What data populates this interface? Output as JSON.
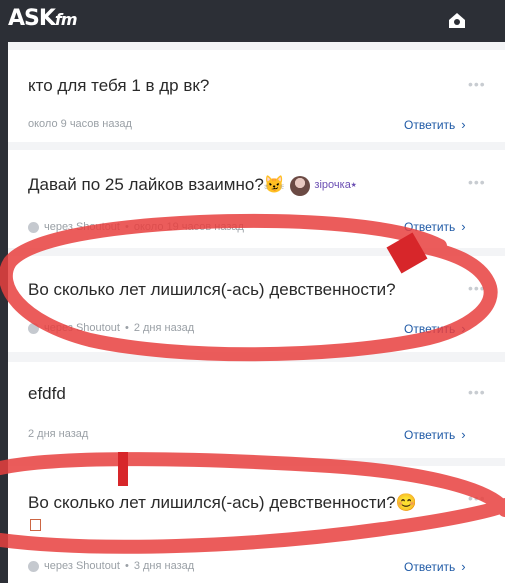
{
  "app": {
    "logo_main": "ASK",
    "logo_sub": "fm"
  },
  "colors": {
    "accent_link": "#1f5aa6",
    "scribble": "#e8403e"
  },
  "questions": [
    {
      "text": "кто для тебя 1 в др вк?",
      "via": "",
      "time": "около 9 часов назад",
      "answer_label": "Ответить"
    },
    {
      "text": "Давай по 25 лайков взаимно?😼",
      "via": "через Shoutout",
      "time": "около 19 часов назад",
      "answer_label": "Ответить",
      "user": "зірочка⭑"
    },
    {
      "text": "Во сколько лет лишился(-ась) девственности?",
      "via": "через Shoutout",
      "time": "2 дня назад",
      "answer_label": "Ответить"
    },
    {
      "text": "efdfd",
      "via": "",
      "time": "2 дня назад",
      "answer_label": "Ответить"
    },
    {
      "text": "Во сколько лет лишился(-ась) девственности?😊",
      "via": "через Shoutout",
      "time": "3 дня назад",
      "answer_label": "Ответить"
    }
  ],
  "icons": {
    "more": "more-dots-icon",
    "notifications": "notification-icon",
    "shoutout": "shoutout-icon"
  },
  "meta_sep": "•",
  "more_glyph": "•••",
  "chev_glyph": "›"
}
